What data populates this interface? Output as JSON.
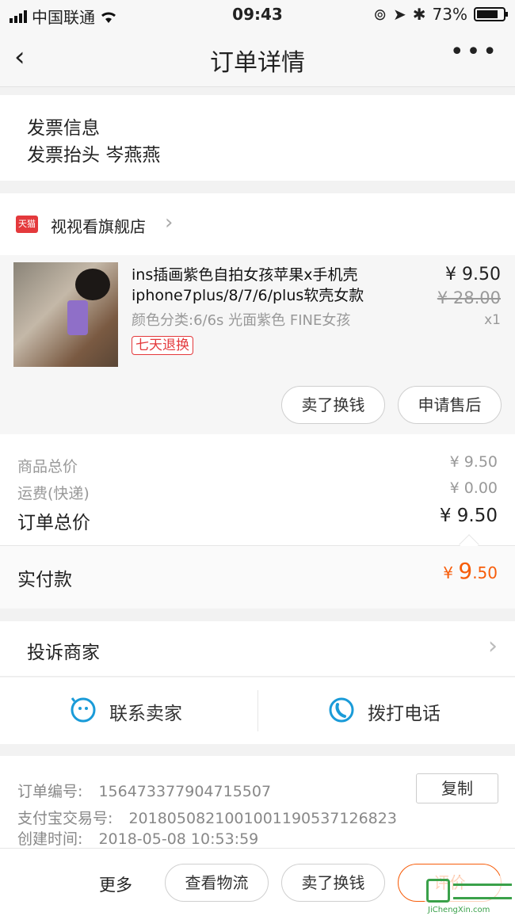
{
  "status_bar": {
    "carrier": "中国联通",
    "time": "09:43",
    "battery": "73%"
  },
  "header": {
    "title": "订单详情",
    "back_icon": "‹",
    "more_icon": "•••"
  },
  "invoice": {
    "title": "发票信息",
    "header_label": "发票抬头",
    "header_value": "岑燕燕"
  },
  "store": {
    "name": "视视看旗舰店",
    "badge": "天猫"
  },
  "product": {
    "title_line1": "ins插画紫色自拍女孩苹果x手机壳",
    "title_line2": "iphone7plus/8/7/6/plus软壳女款",
    "sku": "颜色分类:6/6s 光面紫色 FINE女孩",
    "tag": "七天退换",
    "price": "¥ 9.50",
    "original_price": "¥ 28.00",
    "qty": "x1",
    "btn_sell": "卖了换钱",
    "btn_after_sale": "申请售后"
  },
  "summary": {
    "goods_label": "商品总价",
    "goods_value": "¥ 9.50",
    "freight_label": "运费(快递)",
    "freight_value": "¥ 0.00",
    "total_label": "订单总价",
    "total_value": "¥ 9.50",
    "paid_label": "实付款",
    "paid_currency": "¥",
    "paid_int": "9",
    "paid_dec": ".50"
  },
  "complaint": {
    "label": "投诉商家"
  },
  "contact": {
    "seller": "联系卖家",
    "call": "拨打电话"
  },
  "order_info": {
    "no_label": "订单编号:",
    "no_value": "156473377904715507",
    "copy": "复制",
    "alipay_label": "支付宝交易号:",
    "alipay_value": "2018050821001001190537126823",
    "created_label": "创建时间:",
    "created_value": "2018-05-08 10:53:59"
  },
  "bottom": {
    "more": "更多",
    "logistics": "查看物流",
    "sell": "卖了换钱",
    "review": "评价"
  },
  "watermark": {
    "text": "集城信",
    "url": "JiChengXin.com"
  },
  "colors": {
    "accent": "#e4393c",
    "price_orange": "#f75d0a",
    "icon_blue": "#1a9bd8"
  }
}
